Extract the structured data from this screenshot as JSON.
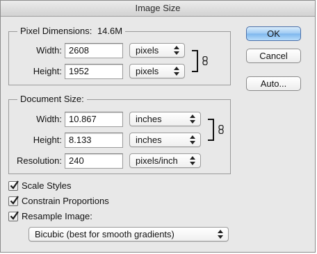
{
  "window": {
    "title": "Image Size"
  },
  "pixel_dimensions": {
    "legend": "Pixel Dimensions:",
    "size": "14.6M",
    "width_label": "Width:",
    "width_value": "2608",
    "width_unit": "pixels",
    "height_label": "Height:",
    "height_value": "1952",
    "height_unit": "pixels"
  },
  "document_size": {
    "legend": "Document Size:",
    "width_label": "Width:",
    "width_value": "10.867",
    "width_unit": "inches",
    "height_label": "Height:",
    "height_value": "8.133",
    "height_unit": "inches",
    "resolution_label": "Resolution:",
    "resolution_value": "240",
    "resolution_unit": "pixels/inch"
  },
  "options": {
    "scale_styles": {
      "label": "Scale Styles",
      "checked": true
    },
    "constrain_proportions": {
      "label": "Constrain Proportions",
      "checked": true
    },
    "resample_image": {
      "label": "Resample Image:",
      "checked": true
    },
    "resample_method": "Bicubic (best for smooth gradients)"
  },
  "buttons": {
    "ok": "OK",
    "cancel": "Cancel",
    "auto": "Auto..."
  },
  "icons": {
    "chain": "chain-link-icon",
    "checkmark": "checkmark-icon",
    "popup_arrows": "updown-arrows-icon"
  },
  "colors": {
    "dialog_bg": "#e8e8e8",
    "default_button": "#9cc9f3",
    "check": "#1a1a1a"
  }
}
